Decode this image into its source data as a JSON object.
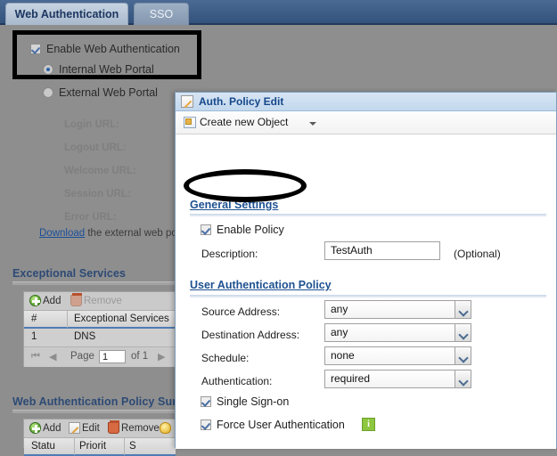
{
  "tabs": [
    {
      "label": "Web Authentication",
      "active": true
    },
    {
      "label": "SSO",
      "active": false
    }
  ],
  "left_panel": {
    "enable_web_auth": {
      "label": "Enable Web Authentication",
      "checked": true
    },
    "portal_options": [
      {
        "label": "Internal Web Portal",
        "selected": true
      },
      {
        "label": "External Web Portal",
        "selected": false
      }
    ],
    "url_fields": [
      {
        "label": "Login URL:"
      },
      {
        "label": "Logout URL:"
      },
      {
        "label": "Welcome URL:"
      },
      {
        "label": "Session URL:"
      },
      {
        "label": "Error URL:"
      }
    ],
    "download_link": "Download",
    "download_text": "the external web po",
    "exceptional_services": {
      "title": "Exceptional Services",
      "toolbar": [
        {
          "label": "Add",
          "icon": "add-icon",
          "enabled": true
        },
        {
          "label": "Remove",
          "icon": "trash-icon",
          "enabled": false
        }
      ],
      "columns": [
        "#",
        "Exceptional Services"
      ],
      "rows": [
        [
          "1",
          "DNS"
        ]
      ],
      "pager": {
        "page_label": "Page",
        "page_value": "1",
        "of_label": "of 1"
      }
    },
    "policy_summary": {
      "title": "Web Authentication Policy Sum",
      "toolbar": [
        {
          "label": "Add",
          "icon": "add-icon",
          "enabled": true
        },
        {
          "label": "Edit",
          "icon": "edit-icon",
          "enabled": true
        },
        {
          "label": "Remove",
          "icon": "trash-icon",
          "enabled": true
        },
        {
          "label": "",
          "icon": "bulb-icon",
          "enabled": true
        }
      ],
      "columns": [
        "Statu",
        "Priorit",
        "S"
      ]
    }
  },
  "dialog": {
    "title": "Auth. Policy Edit",
    "title_icon": "pencil-edit-icon",
    "toolbar": {
      "create_new_object": "Create new Object",
      "icon": "new-object-icon"
    },
    "general_settings": {
      "title": "General Settings",
      "enable_policy": {
        "label": "Enable Policy",
        "checked": true
      },
      "description": {
        "label": "Description:",
        "value": "TestAuth",
        "hint": "(Optional)"
      }
    },
    "user_auth_policy": {
      "title": "User Authentication Policy",
      "fields": [
        {
          "label": "Source Address:",
          "value": "any"
        },
        {
          "label": "Destination Address:",
          "value": "any"
        },
        {
          "label": "Schedule:",
          "value": "none"
        },
        {
          "label": "Authentication:",
          "value": "required"
        }
      ],
      "checkboxes": [
        {
          "label": "Single Sign-on",
          "checked": true,
          "info": false
        },
        {
          "label": "Force User Authentication",
          "checked": true,
          "info": true,
          "info_glyph": "i"
        }
      ]
    }
  },
  "annotations": {
    "highlight_box_label": "enable-web-auth-highlight",
    "highlight_oval_label": "enable-policy-highlight"
  }
}
